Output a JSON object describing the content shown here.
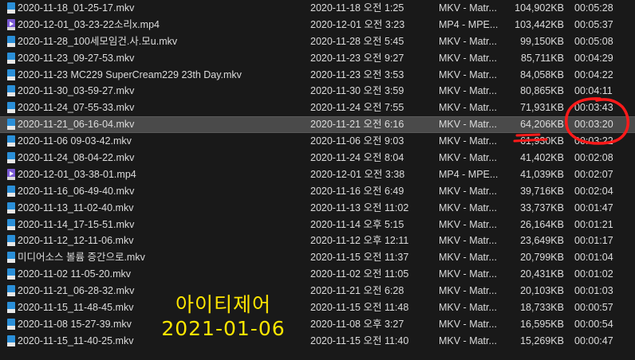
{
  "files": [
    {
      "icon": "mkv",
      "name": "2020-11-18_01-25-17.mkv",
      "date": "2020-11-18 오전 1:25",
      "type": "MKV - Matr...",
      "size": "104,902KB",
      "duration": "00:05:28"
    },
    {
      "icon": "mp4",
      "name": "2020-12-01_03-23-22소리x.mp4",
      "date": "2020-12-01 오전 3:23",
      "type": "MP4 - MPE...",
      "size": "103,442KB",
      "duration": "00:05:37"
    },
    {
      "icon": "mkv",
      "name": "2020-11-28_100세모임건.사.모u.mkv",
      "date": "2020-11-28 오전 5:45",
      "type": "MKV - Matr...",
      "size": "99,150KB",
      "duration": "00:05:08"
    },
    {
      "icon": "mkv",
      "name": "2020-11-23_09-27-53.mkv",
      "date": "2020-11-23 오전 9:27",
      "type": "MKV - Matr...",
      "size": "85,711KB",
      "duration": "00:04:29"
    },
    {
      "icon": "mkv",
      "name": "2020-11-23 MC229 SuperCream229 23th Day.mkv",
      "date": "2020-11-23 오전 3:53",
      "type": "MKV - Matr...",
      "size": "84,058KB",
      "duration": "00:04:22"
    },
    {
      "icon": "mkv",
      "name": "2020-11-30_03-59-27.mkv",
      "date": "2020-11-30 오전 3:59",
      "type": "MKV - Matr...",
      "size": "80,865KB",
      "duration": "00:04:11"
    },
    {
      "icon": "mkv",
      "name": "2020-11-24_07-55-33.mkv",
      "date": "2020-11-24 오전 7:55",
      "type": "MKV - Matr...",
      "size": "71,931KB",
      "duration": "00:03:43"
    },
    {
      "icon": "mkv",
      "name": "2020-11-21_06-16-04.mkv",
      "date": "2020-11-21 오전 6:16",
      "type": "MKV - Matr...",
      "size": "64,206KB",
      "duration": "00:03:20"
    },
    {
      "icon": "mkv",
      "name": "2020-11-06 09-03-42.mkv",
      "date": "2020-11-06 오전 9:03",
      "type": "MKV - Matr...",
      "size": "61,930KB",
      "duration": "00:03:22"
    },
    {
      "icon": "mkv",
      "name": "2020-11-24_08-04-22.mkv",
      "date": "2020-11-24 오전 8:04",
      "type": "MKV - Matr...",
      "size": "41,402KB",
      "duration": "00:02:08"
    },
    {
      "icon": "mp4",
      "name": "2020-12-01_03-38-01.mp4",
      "date": "2020-12-01 오전 3:38",
      "type": "MP4 - MPE...",
      "size": "41,039KB",
      "duration": "00:02:07"
    },
    {
      "icon": "mkv",
      "name": "2020-11-16_06-49-40.mkv",
      "date": "2020-11-16 오전 6:49",
      "type": "MKV - Matr...",
      "size": "39,716KB",
      "duration": "00:02:04"
    },
    {
      "icon": "mkv",
      "name": "2020-11-13_11-02-40.mkv",
      "date": "2020-11-13 오전 11:02",
      "type": "MKV - Matr...",
      "size": "33,737KB",
      "duration": "00:01:47"
    },
    {
      "icon": "mkv",
      "name": "2020-11-14_17-15-51.mkv",
      "date": "2020-11-14 오후 5:15",
      "type": "MKV - Matr...",
      "size": "26,164KB",
      "duration": "00:01:21"
    },
    {
      "icon": "mkv",
      "name": "2020-11-12_12-11-06.mkv",
      "date": "2020-11-12 오후 12:11",
      "type": "MKV - Matr...",
      "size": "23,649KB",
      "duration": "00:01:17"
    },
    {
      "icon": "mkv",
      "name": "미디어소스 볼륨 증간으로.mkv",
      "date": "2020-11-15 오전 11:37",
      "type": "MKV - Matr...",
      "size": "20,799KB",
      "duration": "00:01:04"
    },
    {
      "icon": "mkv",
      "name": "2020-11-02 11-05-20.mkv",
      "date": "2020-11-02 오전 11:05",
      "type": "MKV - Matr...",
      "size": "20,431KB",
      "duration": "00:01:02"
    },
    {
      "icon": "mkv",
      "name": "2020-11-21_06-28-32.mkv",
      "date": "2020-11-21 오전 6:28",
      "type": "MKV - Matr...",
      "size": "20,103KB",
      "duration": "00:01:03"
    },
    {
      "icon": "mkv",
      "name": "2020-11-15_11-48-45.mkv",
      "date": "2020-11-15 오전 11:48",
      "type": "MKV - Matr...",
      "size": "18,733KB",
      "duration": "00:00:57"
    },
    {
      "icon": "mkv",
      "name": "2020-11-08 15-27-39.mkv",
      "date": "2020-11-08 오후 3:27",
      "type": "MKV - Matr...",
      "size": "16,595KB",
      "duration": "00:00:54"
    },
    {
      "icon": "mkv",
      "name": "2020-11-15_11-40-25.mkv",
      "date": "2020-11-15 오전 11:40",
      "type": "MKV - Matr...",
      "size": "15,269KB",
      "duration": "00:00:47"
    }
  ],
  "selected_index": 7,
  "watermark": {
    "line1": "아이티제어",
    "line2": "2021-01-06",
    "color": "#ffe600"
  },
  "annotation_color": "#ff1a1a"
}
